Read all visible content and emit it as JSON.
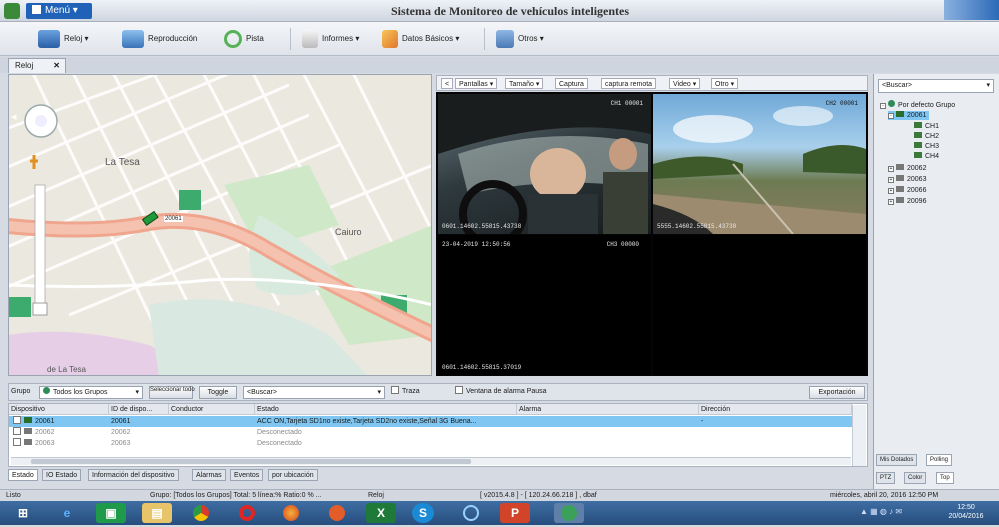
{
  "window": {
    "title": "Sistema de Monitoreo de vehículos inteligentes",
    "menu_label": "Menú"
  },
  "toolbar": {
    "items": [
      {
        "label": "Reloj",
        "icon": "clock-icon"
      },
      {
        "label": "Reproducción",
        "icon": "monitor-icon"
      },
      {
        "label": "Pista",
        "icon": "track-icon"
      },
      {
        "label": "Informes",
        "icon": "report-icon"
      },
      {
        "label": "Datos Básicos",
        "icon": "pencil-icon"
      },
      {
        "label": "Otros",
        "icon": "other-icon"
      }
    ]
  },
  "tabs": {
    "active": "Reloj",
    "close_glyph": "✕"
  },
  "map": {
    "labels": {
      "la_tesa": "La Tesa",
      "caiuro": "Caiuro",
      "la_tesa_bottom": "de La Tesa",
      "vehicle": "20061"
    }
  },
  "video_toolbar": {
    "items": [
      "<",
      "Pantallas",
      "Tamaño",
      "Captura",
      "captura remota",
      "Video",
      "Otro"
    ]
  },
  "video_panes": [
    {
      "osd_top_left": "",
      "osd_top_right": "CH1 00001",
      "osd_bottom": "0601.14602.55815.43738"
    },
    {
      "osd_top_left": "",
      "osd_top_right": "CH2 00001",
      "osd_bottom": "5555.14602.55815.43738"
    },
    {
      "osd_top_left": "23-04-2019 12:50:56",
      "osd_top_right": "CH3 00000",
      "osd_bottom": "0601.14602.55815.37019"
    },
    {
      "osd_top_left": "",
      "osd_top_right": "",
      "osd_bottom": ""
    }
  ],
  "device_tree": {
    "search_placeholder": "<Buscar>",
    "root": "Por defecto Grupo",
    "nodes": [
      {
        "label": "20061",
        "selected": true,
        "channels": [
          "CH1",
          "CH2",
          "CH3",
          "CH4"
        ]
      },
      {
        "label": "20062"
      },
      {
        "label": "20063"
      },
      {
        "label": "20066"
      },
      {
        "label": "20096"
      }
    ],
    "tabs_top": [
      "Mis Dotados",
      "Polling"
    ],
    "tabs_bottom": [
      "PTZ",
      "Color",
      "Top"
    ]
  },
  "filter_bar": {
    "group_label": "Grupo",
    "group_value": "Todos los Grupos",
    "select_all": "Seleccionar todo",
    "toggle": "Toggle",
    "search_placeholder": "<Buscar>",
    "trace_label": "Traza",
    "alarm_window_label": "Ventana de alarma Pausa",
    "export": "Exportación"
  },
  "device_table": {
    "columns": [
      "Dispositivo",
      "ID de dispo...",
      "Conductor",
      "Estado",
      "Alarma",
      "Dirección"
    ],
    "rows": [
      {
        "device": "20061",
        "id": "20061",
        "driver": "",
        "status": "ACC ON,Tarjeta SD1no existe,Tarjeta SD2no existe,Señal 3G Buena...",
        "alarm": "",
        "address": "-",
        "selected": true
      },
      {
        "device": "20062",
        "id": "20062",
        "driver": "",
        "status": "Desconectado",
        "alarm": "",
        "address": "",
        "selected": false
      },
      {
        "device": "20063",
        "id": "20063",
        "driver": "",
        "status": "Desconectado",
        "alarm": "",
        "address": "",
        "selected": false
      }
    ]
  },
  "bottom_tabs": [
    "Estado",
    "IO Estado",
    "Información del dispositivo",
    "Alarmas",
    "Eventos",
    "por ubicación"
  ],
  "statusbar": {
    "left": "Listo",
    "group_summary": "Grupo: [Todos los Grupos] Total: 5 línea:% Ratio:0 % ...",
    "clock_label": "Reloj",
    "version": "[ v2015.4.8 ] - [ 120.24.66.218 ] , dbaf",
    "datetime": "miércoles, abril 20, 2016 12:50 PM"
  },
  "taskbar": {
    "time": "12:50",
    "date": "20/04/2016"
  },
  "colors": {
    "accent": "#1f62b8",
    "selection": "#7fc7f2",
    "map_road": "#f0a58e",
    "map_park": "#bfe3c0",
    "map_water": "#a9d0df"
  }
}
